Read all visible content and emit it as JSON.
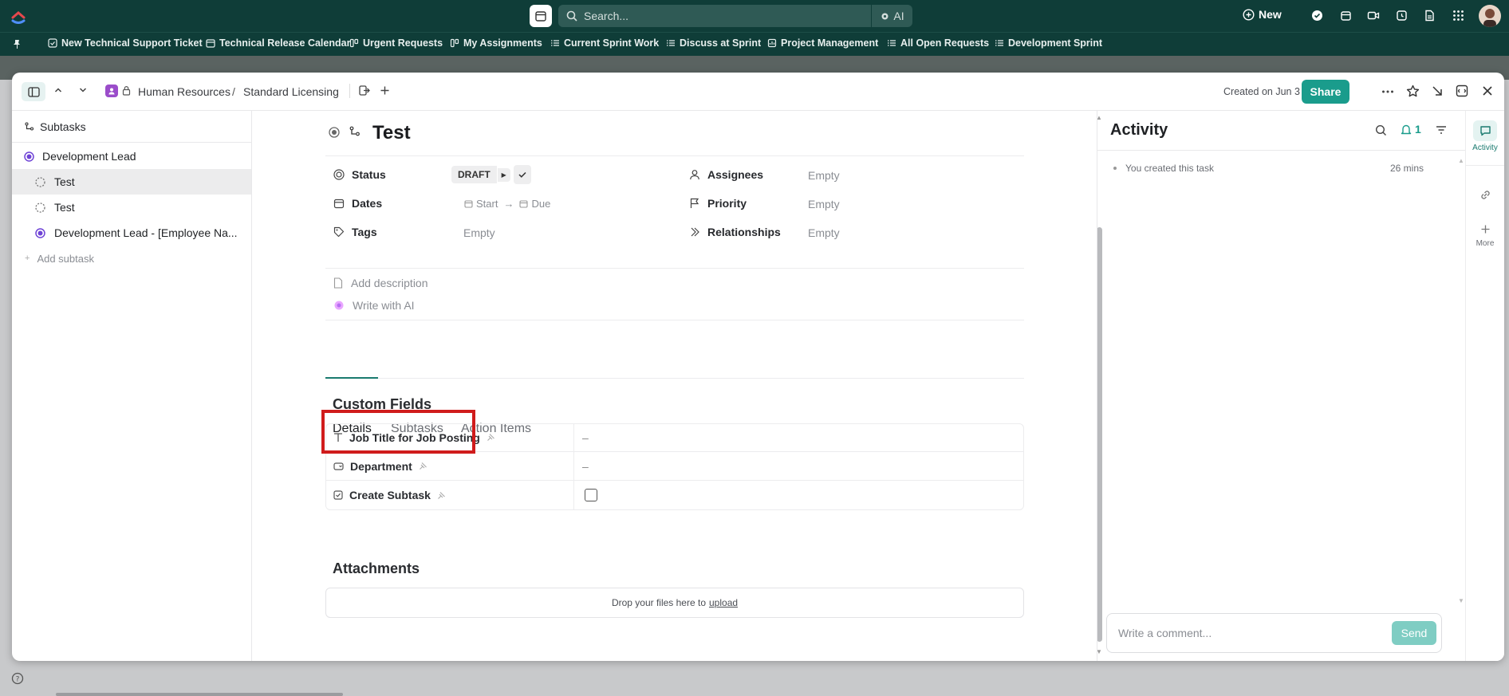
{
  "topbar": {
    "search_placeholder": "Search...",
    "ai_label": "AI",
    "new_label": "New"
  },
  "bookmarks": [
    "New Technical Support Ticket",
    "Technical Release Calendar",
    "Urgent Requests",
    "My Assignments",
    "Current Sprint Work",
    "Discuss at Sprint",
    "Project Management",
    "All Open Requests",
    "Development Sprint"
  ],
  "header": {
    "breadcrumb_space": "Human Resources",
    "breadcrumb_sep": "/",
    "breadcrumb_list": "Standard Licensing",
    "created": "Created on Jun 3",
    "share": "Share"
  },
  "subtasks_panel": {
    "title": "Subtasks",
    "parent": "Development Lead",
    "items": [
      "Test",
      "Test",
      "Development Lead - [Employee Na..."
    ],
    "add": "Add subtask"
  },
  "task": {
    "title": "Test",
    "status_label": "Status",
    "status_value": "DRAFT",
    "dates_label": "Dates",
    "start": "Start",
    "due": "Due",
    "tags_label": "Tags",
    "tags_value": "Empty",
    "assignees_label": "Assignees",
    "assignees_value": "Empty",
    "priority_label": "Priority",
    "priority_value": "Empty",
    "relationships_label": "Relationships",
    "relationships_value": "Empty",
    "add_description": "Add description",
    "write_ai": "Write with AI"
  },
  "tabs": [
    "Details",
    "Subtasks",
    "Action Items"
  ],
  "custom_fields": {
    "title": "Custom Fields",
    "rows": [
      {
        "name": "Job Title for Job Posting",
        "value": "–"
      },
      {
        "name": "Department",
        "value": "–"
      },
      {
        "name": "Create Subtask",
        "value": ""
      }
    ]
  },
  "attachments": {
    "title": "Attachments",
    "drop_text": "Drop your files here to",
    "upload": "upload"
  },
  "activity": {
    "title": "Activity",
    "notif_count": "1",
    "entry": "You created this task",
    "time": "26 mins",
    "comment_placeholder": "Write a comment...",
    "send": "Send"
  },
  "right_rail": {
    "activity": "Activity",
    "more": "More"
  },
  "colors": {
    "brand_dark": "#0f3d38",
    "accent": "#1a9c8c",
    "highlight_box": "#d01c1c"
  }
}
